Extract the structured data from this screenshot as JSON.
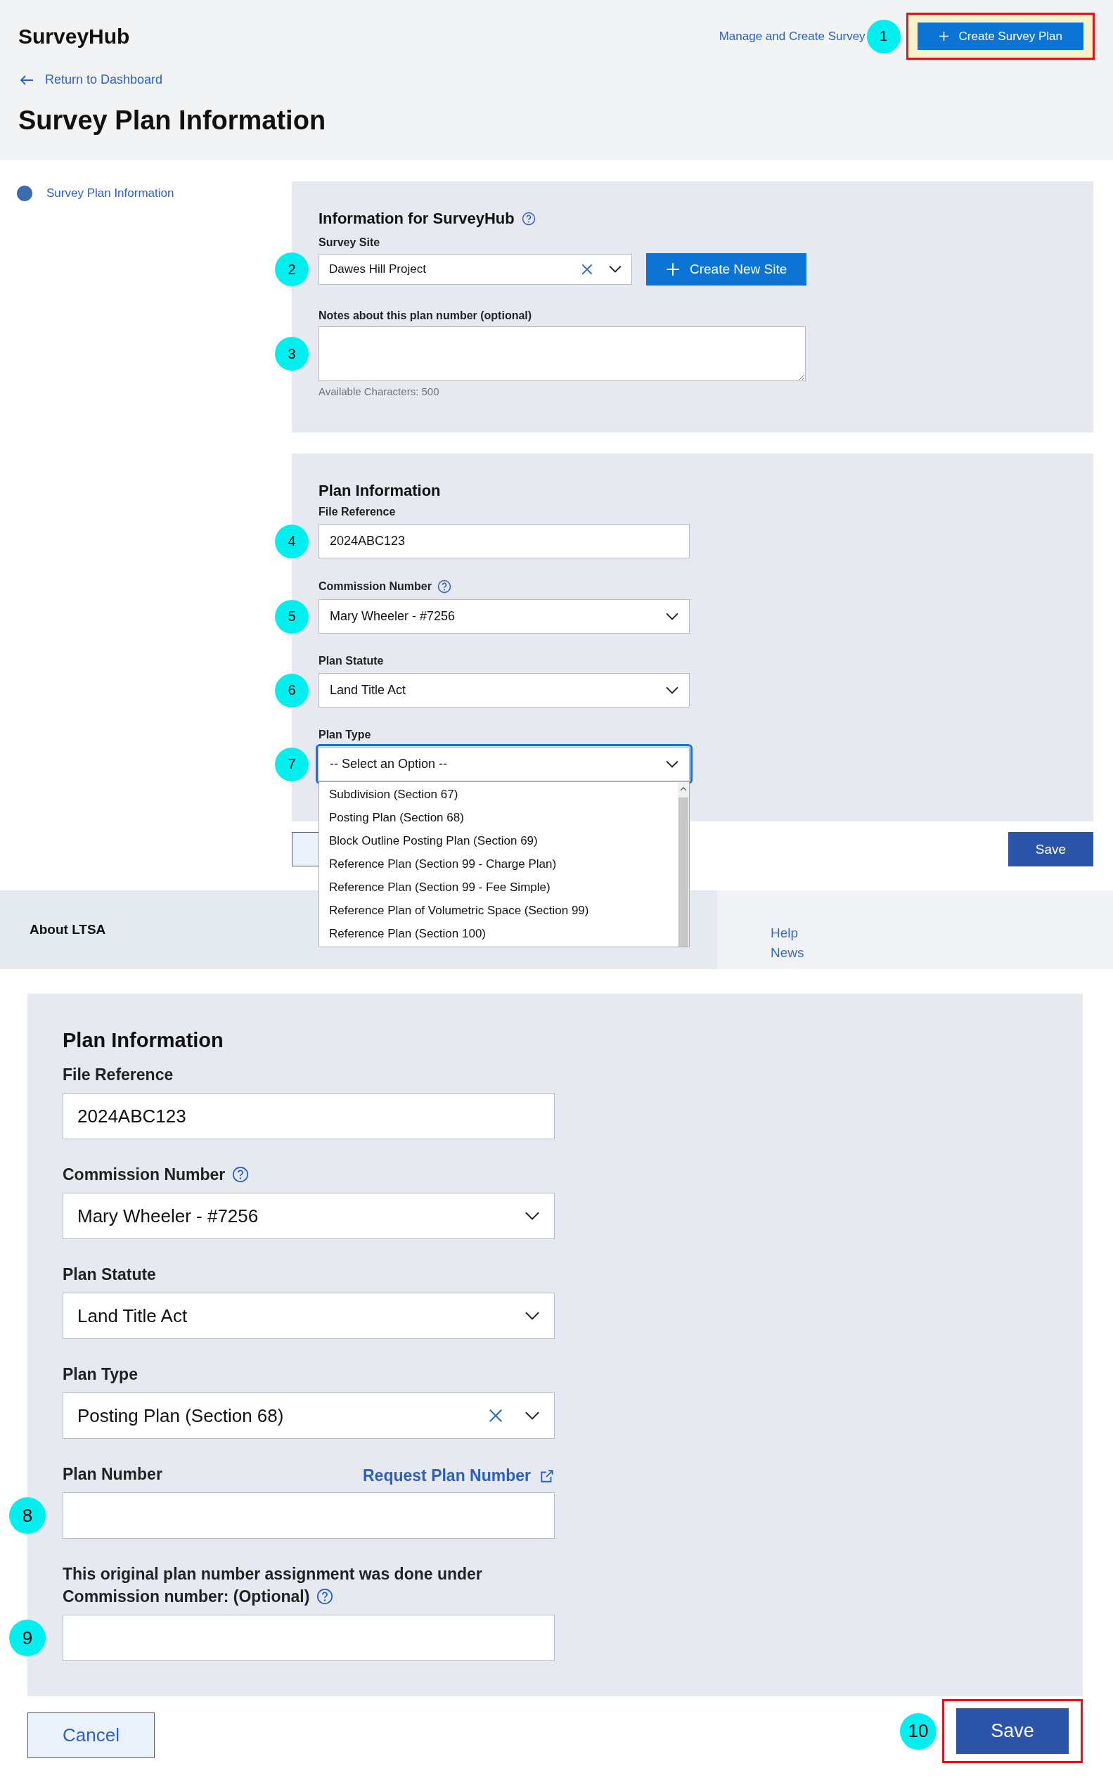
{
  "header": {
    "brand": "SurveyHub",
    "nav_link": "Manage and Create Survey",
    "nav_marker": "1",
    "create_button": {
      "label": "Create Survey Plan",
      "highlighted": true
    }
  },
  "back_link": "Return to Dashboard",
  "page_title": "Survey Plan Information",
  "sidebar": {
    "items": [
      {
        "label": "Survey Plan Information",
        "selected": true
      }
    ]
  },
  "site_panel": {
    "title": "Information for SurveyHub",
    "site_field": {
      "label": "Survey Site",
      "value": "Dawes Hill Project",
      "marker": "2",
      "clearable": true
    },
    "create_site_button": "Create New Site",
    "notes_field": {
      "label": "Notes about this plan number (optional)",
      "marker": "3"
    },
    "char_count": "Available Characters: 500"
  },
  "plan_panel": {
    "title": "Plan Information",
    "fields": [
      {
        "kind": "input",
        "label": "File Reference",
        "value": "2024ABC123",
        "marker": "4"
      },
      {
        "kind": "select",
        "label": "Commission Number",
        "help": true,
        "value": "Mary Wheeler - #7256",
        "marker": "5"
      },
      {
        "kind": "select",
        "label": "Plan Statute",
        "value": "Land Title Act",
        "marker": "6"
      },
      {
        "kind": "select",
        "label": "Plan Type",
        "value": "-- Select an Option --",
        "marker": "7",
        "focused": true,
        "options": [
          "Subdivision (Section 67)",
          "Posting Plan (Section 68)",
          "Block Outline Posting Plan (Section 69)",
          "Reference Plan (Section 99 - Charge Plan)",
          "Reference Plan (Section 99 - Fee Simple)",
          "Reference Plan of Volumetric Space (Section 99)",
          "Reference Plan (Section 100)"
        ]
      }
    ]
  },
  "form_actions": {
    "save": "Save"
  },
  "footer": {
    "heading": "About LTSA",
    "links": [
      "Help",
      "News"
    ]
  },
  "detail": {
    "title": "Plan Information",
    "fields": [
      {
        "kind": "input",
        "label": "File Reference",
        "value": "2024ABC123"
      },
      {
        "kind": "select",
        "label": "Commission Number",
        "help": true,
        "value": "Mary Wheeler - #7256"
      },
      {
        "kind": "select",
        "label": "Plan Statute",
        "value": "Land Title Act"
      },
      {
        "kind": "select",
        "label": "Plan Type",
        "value": "Posting Plan (Section 68)",
        "clearable": true
      },
      {
        "kind": "input",
        "label": "Plan Number",
        "link": "Request Plan Number",
        "marker": "8"
      },
      {
        "kind": "input",
        "label": "This original plan number assignment was done under Commission number: (Optional)",
        "help": true,
        "marker": "9"
      }
    ],
    "cancel": "Cancel",
    "save": {
      "label": "Save",
      "marker": "10",
      "highlighted": true
    }
  }
}
